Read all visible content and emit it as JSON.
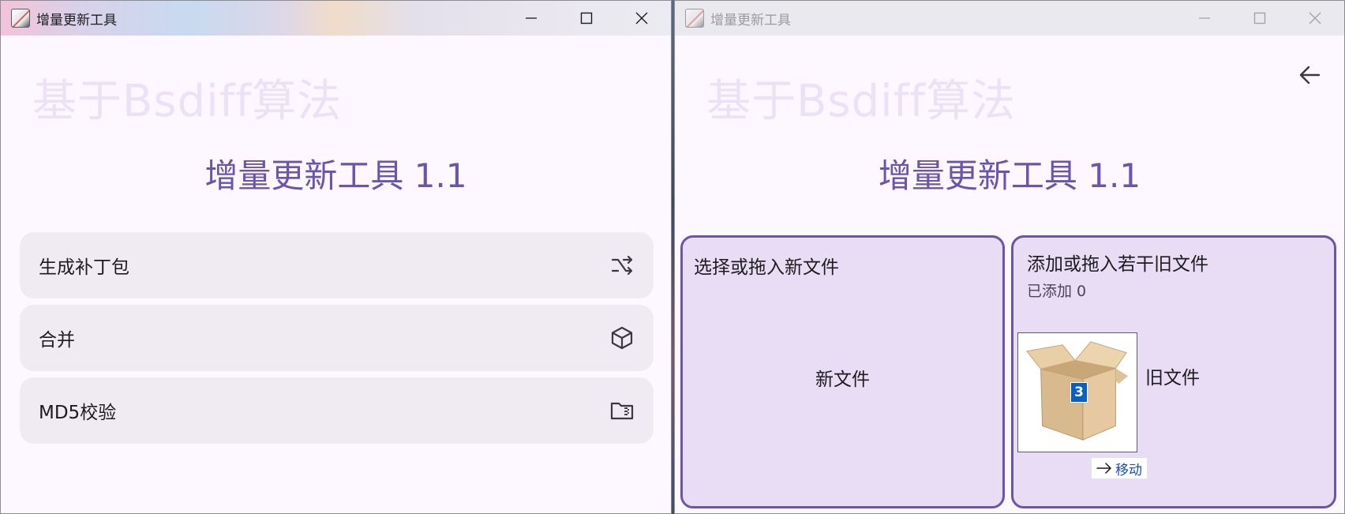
{
  "left_window": {
    "title": "增量更新工具",
    "watermark": "基于Bsdiff算法",
    "heading": "增量更新工具 1.1",
    "menu": [
      {
        "label": "生成补丁包",
        "icon": "shuffle-arrow-icon"
      },
      {
        "label": "合并",
        "icon": "cube-package-icon"
      },
      {
        "label": "MD5校验",
        "icon": "folder-zip-icon"
      }
    ]
  },
  "right_window": {
    "title": "增量更新工具",
    "watermark": "基于Bsdiff算法",
    "heading": "增量更新工具 1.1",
    "new_panel": {
      "title": "选择或拖入新文件",
      "label": "新文件"
    },
    "old_panel": {
      "title": "添加或拖入若干旧文件",
      "count_text": "已添加 0",
      "label": "旧文件",
      "drag_badge": "3",
      "drag_tooltip": "移动"
    }
  },
  "colors": {
    "accent": "#6b55a6",
    "heading": "#6a55a8",
    "card_bg": "#f0eaf2",
    "panel_bg": "#e8ddf5",
    "window_bg": "#fdf7ff"
  }
}
